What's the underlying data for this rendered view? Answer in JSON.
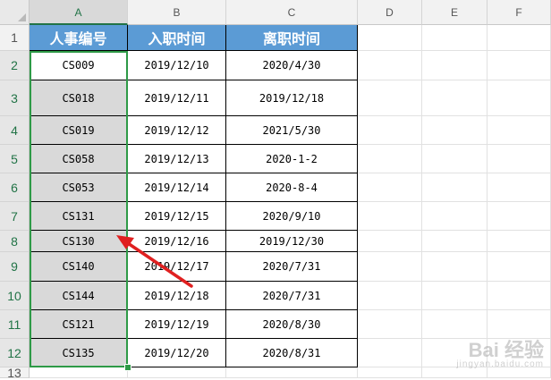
{
  "columns": [
    "A",
    "B",
    "C",
    "D",
    "E",
    "F"
  ],
  "rows": [
    "1",
    "2",
    "3",
    "4",
    "5",
    "6",
    "7",
    "8",
    "9",
    "10",
    "11",
    "12",
    "13"
  ],
  "table": {
    "headers": [
      "人事编号",
      "入职时间",
      "离职时间"
    ],
    "records": [
      [
        "CS009",
        "2019/12/10",
        "2020/4/30"
      ],
      [
        "CS018",
        "2019/12/11",
        "2019/12/18"
      ],
      [
        "CS019",
        "2019/12/12",
        "2021/5/30"
      ],
      [
        "CS058",
        "2019/12/13",
        "2020-1-2"
      ],
      [
        "CS053",
        "2019/12/14",
        "2020-8-4"
      ],
      [
        "CS131",
        "2019/12/15",
        "2020/9/10"
      ],
      [
        "CS130",
        "2019/12/16",
        "2019/12/30"
      ],
      [
        "CS140",
        "2019/12/17",
        "2020/7/31"
      ],
      [
        "CS144",
        "2019/12/18",
        "2020/7/31"
      ],
      [
        "CS121",
        "2019/12/19",
        "2020/8/30"
      ],
      [
        "CS135",
        "2019/12/20",
        "2020/8/31"
      ]
    ]
  },
  "selection": {
    "range": "A2:A12",
    "active_cell": "A2"
  },
  "colors": {
    "header_fill": "#5b9bd5",
    "selection_border": "#2e9a47",
    "arrow": "#e02020"
  },
  "watermark": {
    "main": "Bai 经验",
    "sub": "jingyan.baidu.com"
  }
}
